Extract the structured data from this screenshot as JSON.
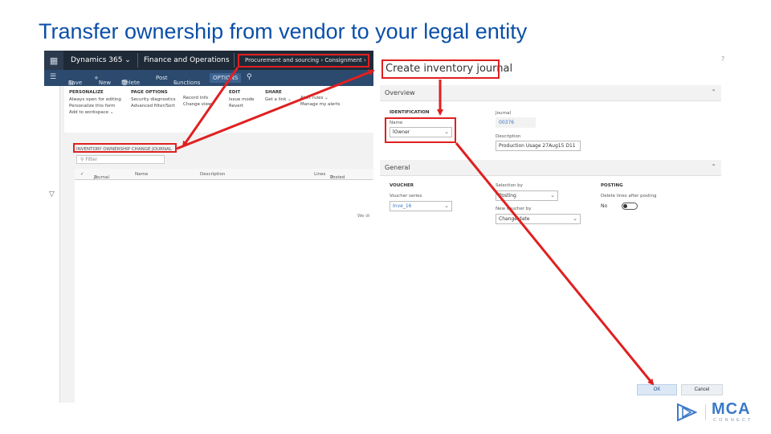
{
  "slide": {
    "title": "Transfer ownership from vendor to your legal entity"
  },
  "d365": {
    "topbar": {
      "brand": "Dynamics 365",
      "app": "Finance and Operations",
      "breadcrumb": "Procurement and sourcing  ›  Consignment  ›"
    },
    "actionbar": {
      "save": "Save",
      "new": "New",
      "delete": "Delete",
      "post": "Post",
      "functions": "Functions",
      "options": "OPTIONS"
    },
    "ribbon": {
      "personalize": {
        "header": "PERSONALIZE",
        "items": [
          "Always open for editing",
          "Personalize this form",
          "Add to workspace"
        ]
      },
      "page_options": {
        "header": "PAGE OPTIONS",
        "items": [
          "Security diagnostics",
          "Advanced filter/Sort"
        ]
      },
      "record": {
        "items": [
          "Record info",
          "Change view"
        ]
      },
      "edit": {
        "header": "EDIT",
        "items": [
          "Issue mode",
          "Revert"
        ]
      },
      "share": {
        "header": "SHARE",
        "items": [
          "Get a link",
          "Manage my alerts"
        ]
      },
      "extra": {
        "items": [
          "Alert rules"
        ]
      }
    },
    "grid": {
      "title": "INVENTORY OWNERSHIP CHANGE JOURNAL",
      "filter_placeholder": "Filter",
      "columns": [
        "Journal",
        "Name",
        "Description",
        "Lines",
        "Posted"
      ],
      "empty_text": "We di"
    }
  },
  "dialog": {
    "title": "Create inventory journal",
    "help": "?",
    "overview": {
      "header": "Overview",
      "identification_header": "IDENTIFICATION",
      "name_label": "Name",
      "name_value": "lOwner",
      "journal_label": "Journal",
      "journal_value": "00376",
      "description_label": "Description",
      "description_value": "Production Usage 27Aug15 D11"
    },
    "general": {
      "header": "General",
      "voucher_header": "VOUCHER",
      "voucher_series_label": "Voucher series",
      "voucher_series_value": "Inve_16",
      "selection_by_label": "Selection by",
      "selection_by_value": "Posting",
      "new_voucher_label": "New voucher by",
      "new_voucher_value": "Change date",
      "posting_header": "POSTING",
      "delete_lines_label": "Delete lines after posting",
      "delete_lines_value": "No"
    },
    "buttons": {
      "ok": "OK",
      "cancel": "Cancel"
    }
  },
  "logo": {
    "word": "MCA",
    "sub": "CONNECT"
  },
  "colors": {
    "title_blue": "#0b4fa8",
    "annotation_red": "#e02020",
    "navbar": "#1f2a38",
    "action_bar": "#2b4a6e",
    "logo_blue": "#3b79c7"
  }
}
